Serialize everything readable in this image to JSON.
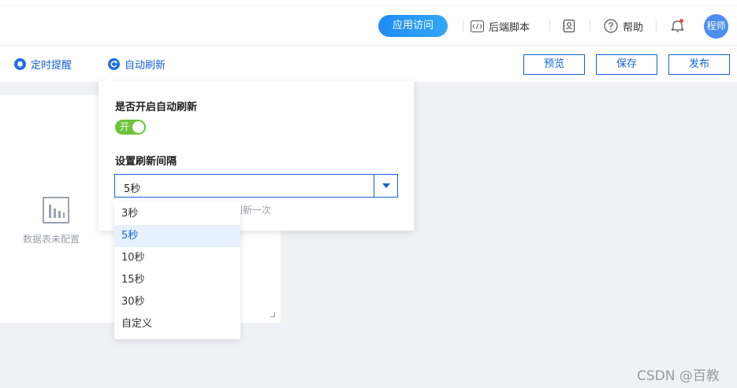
{
  "header": {
    "visit_button": "应用访问",
    "backend_script": "后端脚本",
    "help": "帮助",
    "avatar_text": "程师"
  },
  "toolbar": {
    "timed_reminder": "定时提醒",
    "auto_refresh": "自动刷新",
    "preview": "预览",
    "save": "保存",
    "publish": "发布"
  },
  "card": {
    "empty_text": "数据表未配置"
  },
  "popover": {
    "enable_label": "是否开启自动刷新",
    "toggle_text": "开",
    "interval_label": "设置刷新间隔",
    "selected_value": "5秒",
    "hint_partial": "刷新一次"
  },
  "dropdown": {
    "options": [
      "3秒",
      "5秒",
      "10秒",
      "15秒",
      "30秒",
      "自定义"
    ],
    "selected_index": 1
  },
  "watermark": "CSDN @百教",
  "colors": {
    "accent": "#1563d4",
    "toggle_on": "#6bc43a",
    "visit_button": "#1e8cf5"
  }
}
